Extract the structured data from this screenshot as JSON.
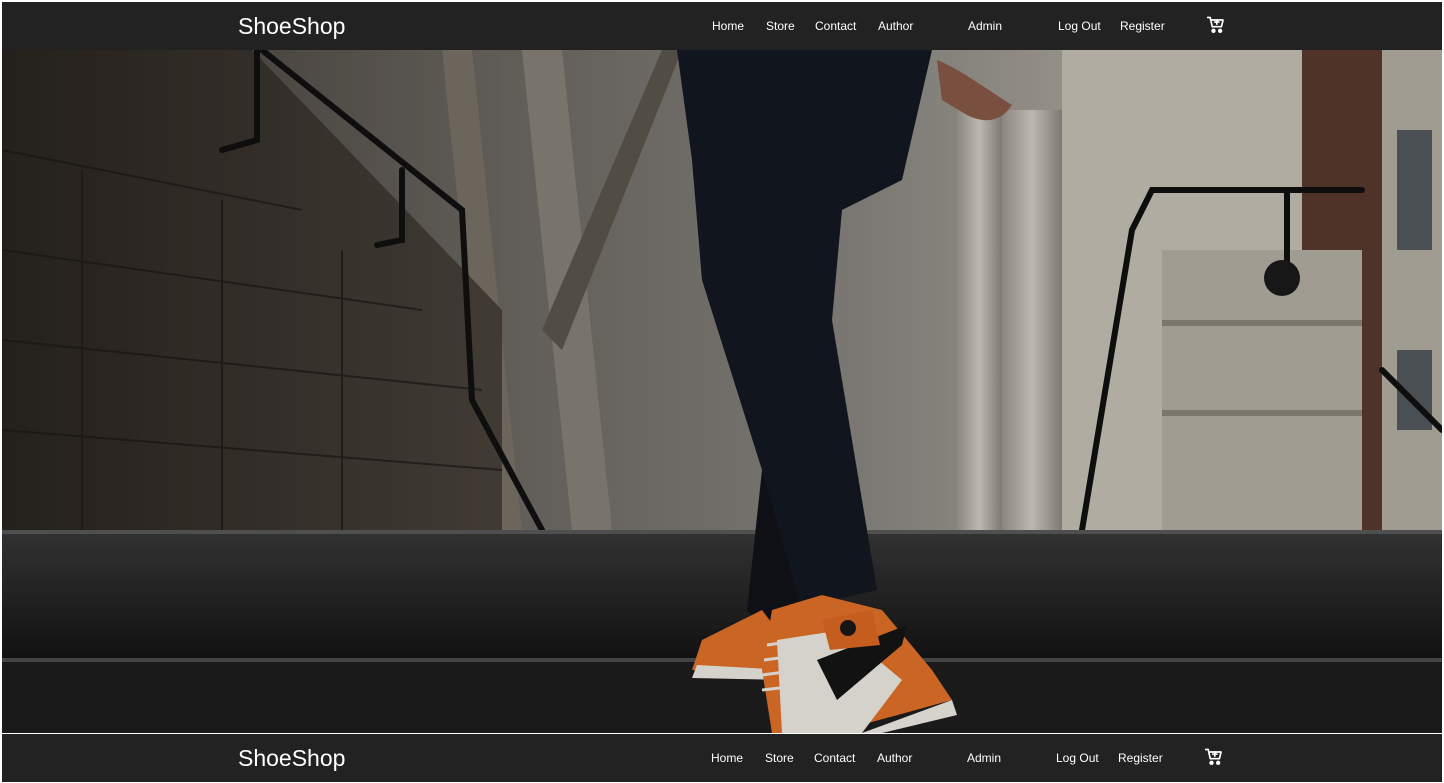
{
  "brand": "ShoeShop",
  "nav": {
    "home": "Home",
    "store": "Store",
    "contact": "Contact",
    "author": "Author",
    "admin": "Admin",
    "logout": "Log Out",
    "register": "Register"
  },
  "icons": {
    "cart": "shopping-cart-icon"
  },
  "colors": {
    "navbar": "#222222",
    "text": "#ffffff",
    "shoe_orange": "#e8742a"
  }
}
